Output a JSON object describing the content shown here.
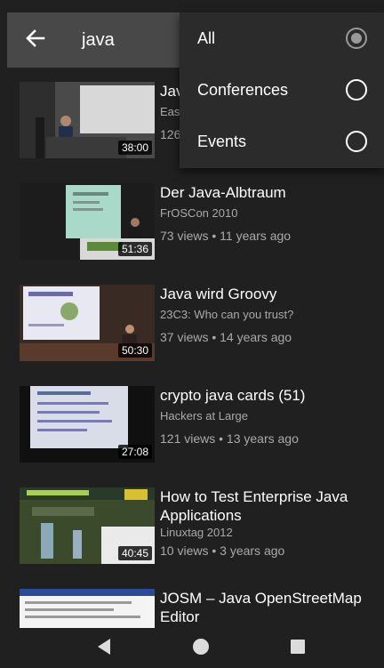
{
  "appbar": {
    "back_icon": "arrow-left-icon",
    "search_query": "java"
  },
  "filter_menu": {
    "options": [
      {
        "label": "All",
        "selected": true
      },
      {
        "label": "Conferences",
        "selected": false
      },
      {
        "label": "Events",
        "selected": false
      }
    ]
  },
  "videos": [
    {
      "title": "Jav",
      "channel": "Eas",
      "stats": "126",
      "duration": "38:00"
    },
    {
      "title": "Der Java-Albtraum",
      "channel": "FrOSCon 2010",
      "stats": "73 views • 11 years ago",
      "duration": "51:36"
    },
    {
      "title": "Java wird Groovy",
      "channel": "23C3: Who can you trust?",
      "stats": "37 views • 14 years ago",
      "duration": "50:30"
    },
    {
      "title": "crypto java cards (51)",
      "channel": "Hackers at Large",
      "stats": "121 views • 13 years ago",
      "duration": "27:08"
    },
    {
      "title": "How to Test Enterprise Java Applications",
      "channel": "Linuxtag 2012",
      "stats": "10 views • 3 years ago",
      "duration": "40:45"
    },
    {
      "title": "JOSM – Java OpenStreetMap Editor",
      "channel": "",
      "stats": "",
      "duration": ""
    }
  ],
  "navbar": {
    "icons": [
      "back-triangle-icon",
      "home-circle-icon",
      "recents-square-icon"
    ]
  },
  "colors": {
    "background": "#202020",
    "appbar": "#484848",
    "menu": "#2b2b2b",
    "secondary_text": "#aaaaaa"
  }
}
